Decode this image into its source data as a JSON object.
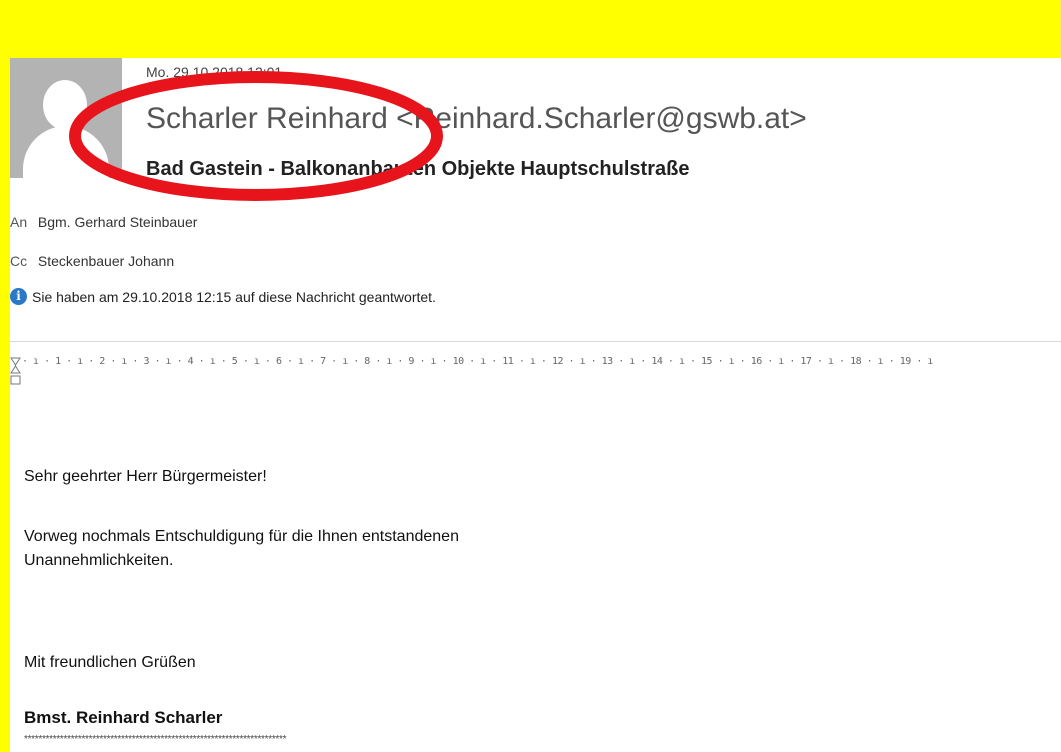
{
  "header": {
    "date": "Mo. 29.10.2018 12:01",
    "sender": "Scharler Reinhard <Reinhard.Scharler@gswb.at>",
    "subject": "Bad Gastein - Balkonanbauten Objekte Hauptschulstraße"
  },
  "recipients": {
    "to_label": "An",
    "to": "Bgm. Gerhard Steinbauer",
    "cc_label": "Cc",
    "cc": "Steckenbauer Johann"
  },
  "info_bar": {
    "icon": "info-icon",
    "text": "Sie haben am 29.10.2018 12:15 auf diese Nachricht geantwortet."
  },
  "ruler": {
    "text": "· ı · 1 · ı · 2 · ı · 3 · ı · 4 · ı · 5 · ı · 6 · ı · 7 · ı · 8 · ı · 9 · ı · 10 · ı · 11 · ı · 12 · ı · 13 · ı · 14 · ı · 15 · ı · 16 · ı · 17 · ı · 18 · ı · 19 · ı"
  },
  "body": {
    "greeting": "Sehr geehrter Herr Bürgermeister!",
    "line1": "Vorweg nochmals Entschuldigung für die Ihnen entstandenen",
    "line2": "Unannehmlichkeiten.",
    "closing": "Mit freundlichen Grüßen",
    "signature": "Bmst. Reinhard Scharler",
    "stars": "*************************************************************************"
  },
  "colors": {
    "background": "#ffff00",
    "highlight_ellipse": "#e8141c",
    "avatar": "#b3b3b3",
    "info_icon": "#2a79c7"
  }
}
